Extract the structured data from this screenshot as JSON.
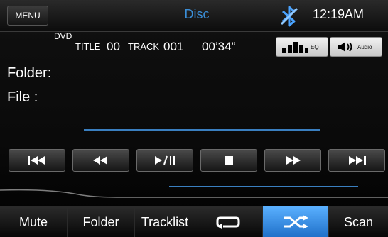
{
  "header": {
    "menu_label": "MENU",
    "title": "Disc",
    "time": "12:19AM",
    "bt_icon": "bluetooth-off-icon"
  },
  "info": {
    "dvd": "DVD",
    "title_label": "TITLE",
    "title_number": "00",
    "track_label": "TRACK",
    "track_number": "001",
    "elapsed": "00’34”"
  },
  "buttons": {
    "eq_label": "EQ",
    "audio_label": "Audio"
  },
  "labels": {
    "folder": "Folder:",
    "file": "File :"
  },
  "controls": [
    "prev-track",
    "rewind",
    "play-pause",
    "stop",
    "fast-forward",
    "next-track"
  ],
  "bottom_tabs": [
    {
      "label": "Mute"
    },
    {
      "label": "Folder"
    },
    {
      "label": "Tracklist"
    },
    {
      "label": ""
    },
    {
      "label": ""
    },
    {
      "label": "Scan"
    }
  ],
  "colors": {
    "accent": "#3b8fd8",
    "active_tab": "#2f86e0"
  }
}
